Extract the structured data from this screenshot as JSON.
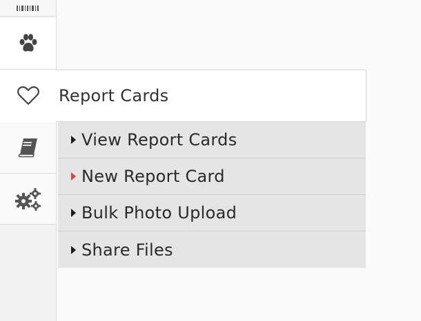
{
  "nav": {
    "icons": [
      "barcode-icon",
      "paw-icon",
      "heart-icon",
      "book-icon",
      "gears-icon"
    ]
  },
  "panel": {
    "title": "Report Cards"
  },
  "submenu": {
    "items": [
      {
        "label": "View Report Cards",
        "active": false
      },
      {
        "label": "New Report Card",
        "active": true
      },
      {
        "label": "Bulk Photo Upload",
        "active": false
      },
      {
        "label": "Share Files",
        "active": false
      }
    ]
  },
  "colors": {
    "active_arrow": "#e04040",
    "submenu_bg": "#e5e5e5",
    "icon": "#444444"
  }
}
